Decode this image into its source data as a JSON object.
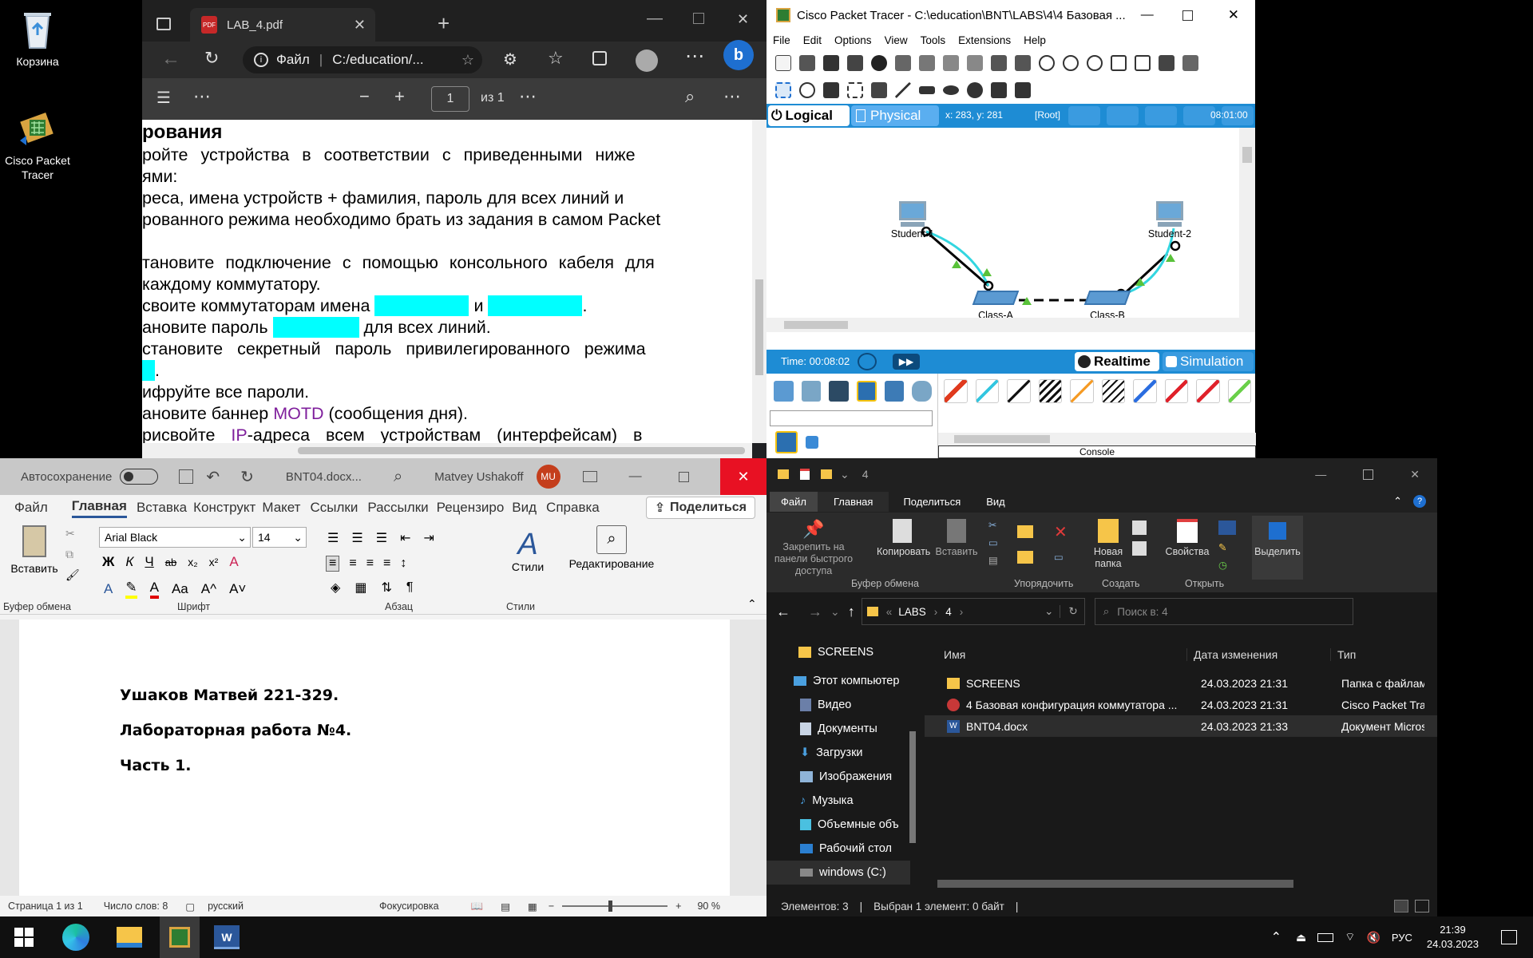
{
  "desktop": {
    "icons": [
      {
        "label": "Корзина",
        "icon": "recycle-bin-icon"
      },
      {
        "label": "Cisco Packet Tracer",
        "icon": "packet-tracer-icon"
      }
    ]
  },
  "edge": {
    "tab_title": "LAB_4.pdf",
    "address_label": "Файл",
    "address_path": "C:/education/...",
    "pdf": {
      "page_current": "1",
      "page_total": "из 1",
      "lines": [
        {
          "before": "рования",
          "bold": true
        },
        {
          "before": "ройте устройства в соответствии с приведенными ниже"
        },
        {
          "before": "ями:"
        },
        {
          "before": "реса, имена устройств + фамилия, пароль для всех линий и"
        },
        {
          "before": "рованного режима необходимо брать из задания в самом Packet"
        },
        {
          "before": ""
        },
        {
          "before": "тановите подключение с помощью консольного кабеля для"
        },
        {
          "before": "каждому коммутатору."
        },
        {
          "before": "своите коммутаторам имена",
          "mid": "и",
          "after": "."
        },
        {
          "before": "ановите пароль",
          "after": "для всех линий."
        },
        {
          "before": "становите секретный пароль привилегированного режима"
        },
        {
          "before": "",
          "after": "."
        },
        {
          "before": "ифруйте все пароли."
        },
        {
          "before": "ановите баннер",
          "purple": "MOTD",
          "after": "(сообщения дня)."
        },
        {
          "before": "рисвойте",
          "purple": "IP",
          "after": "-адреса всем устройствам (интерфейсам) в"
        }
      ]
    }
  },
  "pt": {
    "title": "Cisco Packet Tracer - C:\\education\\BNT\\LABS\\4\\4 Базовая ...",
    "menu": [
      "File",
      "Edit",
      "Options",
      "View",
      "Tools",
      "Extensions",
      "Help"
    ],
    "logical_label": "Logical",
    "physical_label": "Physical",
    "coords": "x: 283, y: 281",
    "root_label": "[Root]",
    "clock": "08:01:00",
    "devices": [
      {
        "name": "Student-1"
      },
      {
        "name": "Student-2"
      },
      {
        "name": "Class-A"
      },
      {
        "name": "Class-B"
      }
    ],
    "time_label": "Time: 00:08:02",
    "realtime_label": "Realtime",
    "simulation_label": "Simulation",
    "console_label": "Console"
  },
  "word": {
    "autosave_label": "Автосохранение",
    "doc_name": "BNT04.docx...",
    "user_name": "Matvey Ushakoff",
    "user_initials": "MU",
    "tabs": [
      "Файл",
      "Главная",
      "Вставка",
      "Конструкт",
      "Макет",
      "Ссылки",
      "Рассылки",
      "Рецензиро",
      "Вид",
      "Справка"
    ],
    "share_label": "Поделиться",
    "paste_label": "Вставить",
    "font_name": "Arial Black",
    "font_size": "14",
    "styles_label": "Стили",
    "editing_label": "Редактирование",
    "groups": [
      "Буфер обмена",
      "Шрифт",
      "Абзац",
      "Стили"
    ],
    "doc_lines": [
      "Ушаков Матвей 221-329.",
      "Лабораторная работа №4.",
      "Часть 1."
    ],
    "status": {
      "page": "Страница 1 из 1",
      "words": "Число слов: 8",
      "lang": "русский",
      "focus": "Фокусировка",
      "zoom": "90 %"
    }
  },
  "explorer": {
    "title": "4",
    "ribbon_tabs": [
      "Файл",
      "Главная",
      "Поделиться",
      "Вид"
    ],
    "actions": [
      {
        "label": "Закрепить на панели быстрого доступа"
      },
      {
        "label": "Копировать"
      },
      {
        "label": "Вставить"
      },
      {
        "label": "Новая папка"
      },
      {
        "label": "Свойства"
      },
      {
        "label": "Выделить"
      }
    ],
    "groups": [
      "Буфер обмена",
      "Упорядочить",
      "Создать",
      "Открыть"
    ],
    "breadcrumb": [
      "LABS",
      "4"
    ],
    "search_placeholder": "Поиск в: 4",
    "nav": [
      "SCREENS",
      "Этот компьютер",
      "Видео",
      "Документы",
      "Загрузки",
      "Изображения",
      "Музыка",
      "Объемные объ",
      "Рабочий стол",
      "windows (C:)"
    ],
    "columns": [
      "Имя",
      "Дата изменения",
      "Тип"
    ],
    "files": [
      {
        "name": "SCREENS",
        "date": "24.03.2023 21:31",
        "type": "Папка с файлам"
      },
      {
        "name": "4 Базовая конфигурация коммутатора ...",
        "date": "24.03.2023 21:31",
        "type": "Cisco Packet Trac"
      },
      {
        "name": "BNT04.docx",
        "date": "24.03.2023 21:33",
        "type": "Документ Micros"
      }
    ],
    "status_count": "Элементов: 3",
    "status_selected": "Выбран 1 элемент: 0 байт"
  },
  "taskbar": {
    "time": "21:39",
    "date": "24.03.2023",
    "lang": "РУС"
  }
}
